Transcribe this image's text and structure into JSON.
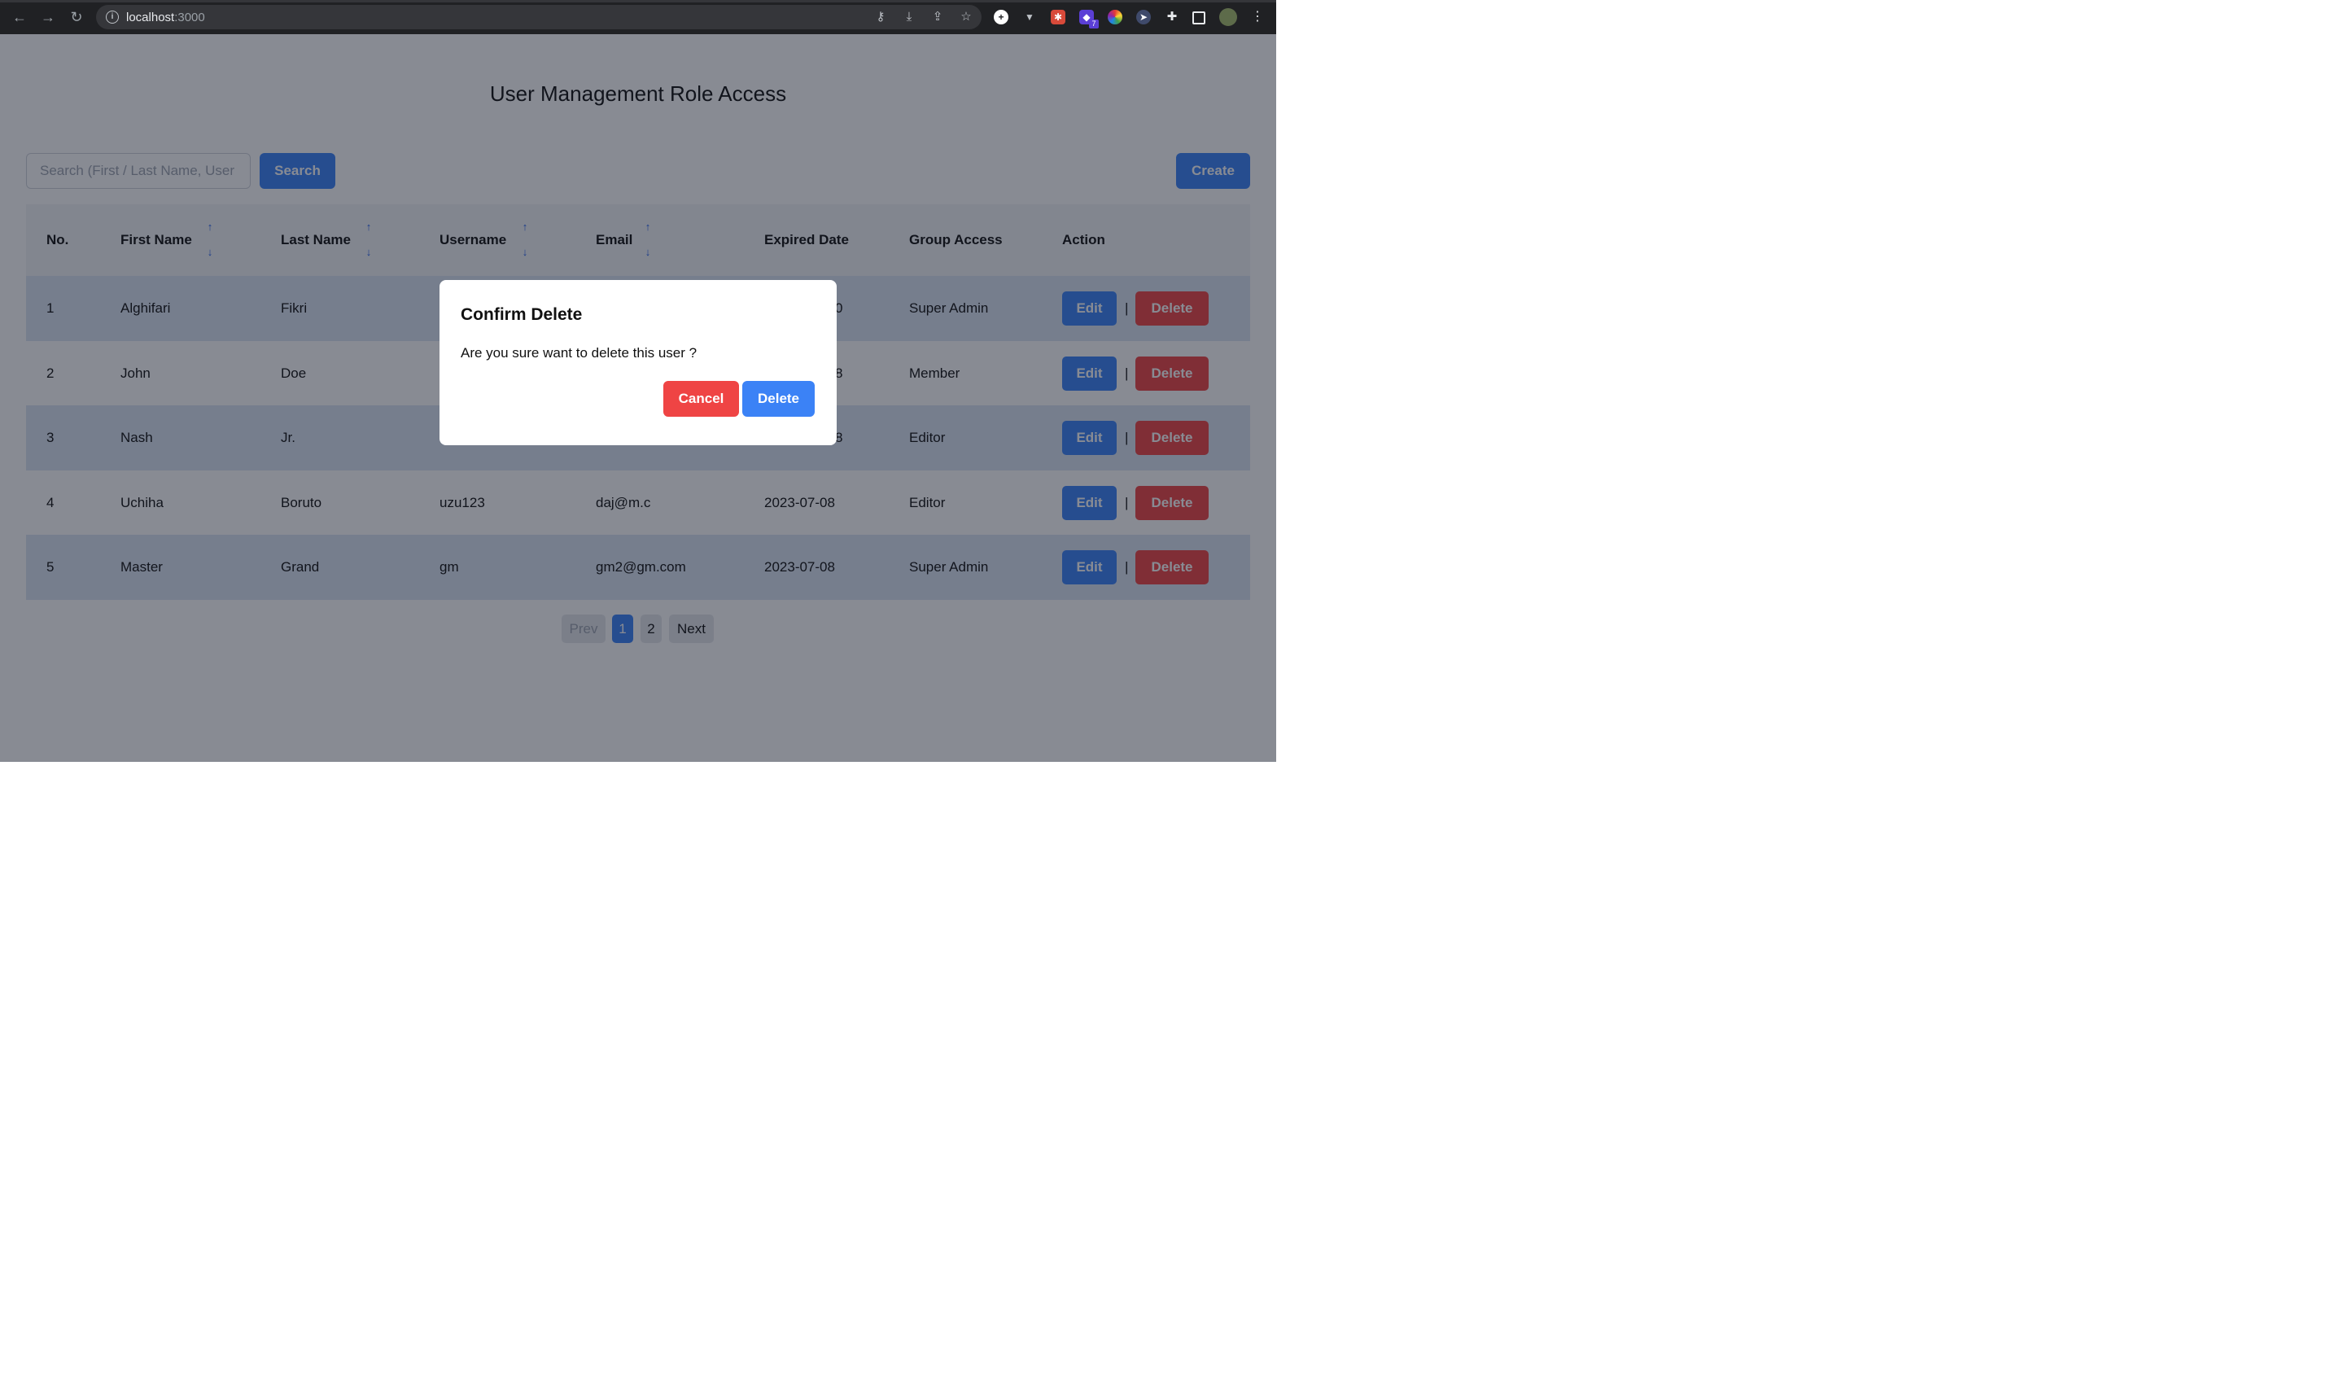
{
  "browser": {
    "url_host": "localhost",
    "url_port": ":3000",
    "extension_badge": "7"
  },
  "page": {
    "title": "User Management Role Access",
    "search_placeholder": "Search (First / Last Name, User",
    "search_label": "Search",
    "create_label": "Create"
  },
  "table": {
    "headers": [
      "No.",
      "First Name",
      "Last Name",
      "Username",
      "Email",
      "Expired Date",
      "Group Access",
      "Action"
    ],
    "sort_up": "↑",
    "sort_down": "↓",
    "edit_label": "Edit",
    "delete_label": "Delete",
    "separator": "|",
    "rows": [
      {
        "no": "1",
        "first": "Alghifari",
        "last": "Fikri",
        "username": "",
        "email": "",
        "expired": "0",
        "group": "Super Admin"
      },
      {
        "no": "2",
        "first": "John",
        "last": "Doe",
        "username": "",
        "email": "",
        "expired": "8",
        "group": "Member"
      },
      {
        "no": "3",
        "first": "Nash",
        "last": "Jr.",
        "username": "",
        "email": "",
        "expired": "8",
        "group": "Editor"
      },
      {
        "no": "4",
        "first": "Uchiha",
        "last": "Boruto",
        "username": "uzu123",
        "email": "daj@m.c",
        "expired": "2023-07-08",
        "group": "Editor"
      },
      {
        "no": "5",
        "first": "Master",
        "last": "Grand",
        "username": "gm",
        "email": "gm2@gm.com",
        "expired": "2023-07-08",
        "group": "Super Admin"
      }
    ]
  },
  "pagination": {
    "prev": "Prev",
    "pages": [
      "1",
      "2"
    ],
    "current": "1",
    "next": "Next"
  },
  "modal": {
    "title": "Confirm Delete",
    "message": "Are you sure want to delete this user ?",
    "cancel_label": "Cancel",
    "delete_label": "Delete"
  },
  "colors": {
    "primary": "#3b82f6",
    "danger": "#ef4444",
    "row_alt": "#dbe4f3",
    "overlay": "rgba(17,24,39,0.5)"
  }
}
